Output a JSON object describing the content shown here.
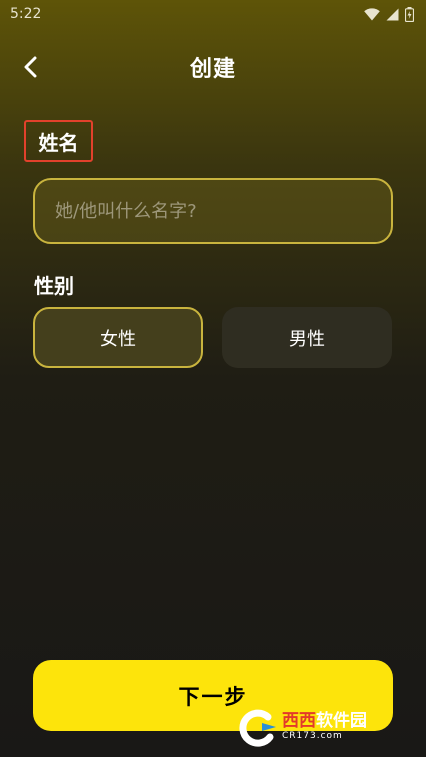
{
  "status_bar": {
    "time": "5:22",
    "icons": [
      "wifi-icon",
      "signal-icon",
      "battery-icon"
    ]
  },
  "header": {
    "back_icon": "chevron-left-icon",
    "title": "创建"
  },
  "form": {
    "name_label": "姓名",
    "name_input": {
      "value": "",
      "placeholder": "她/他叫什么名字?"
    },
    "gender_label": "性别",
    "gender_options": [
      {
        "label": "女性",
        "selected": true
      },
      {
        "label": "男性",
        "selected": false
      }
    ]
  },
  "footer": {
    "next_label": "下一步"
  },
  "watermark": {
    "logo_icon": "cr-swirl-logo-icon",
    "title_red": "西西",
    "title_white": "软件园",
    "subtitle": "CR173.com"
  },
  "colors": {
    "accent_yellow": "#fde40b",
    "border_gold": "#c9b43e",
    "highlight_red": "#e2412c"
  }
}
